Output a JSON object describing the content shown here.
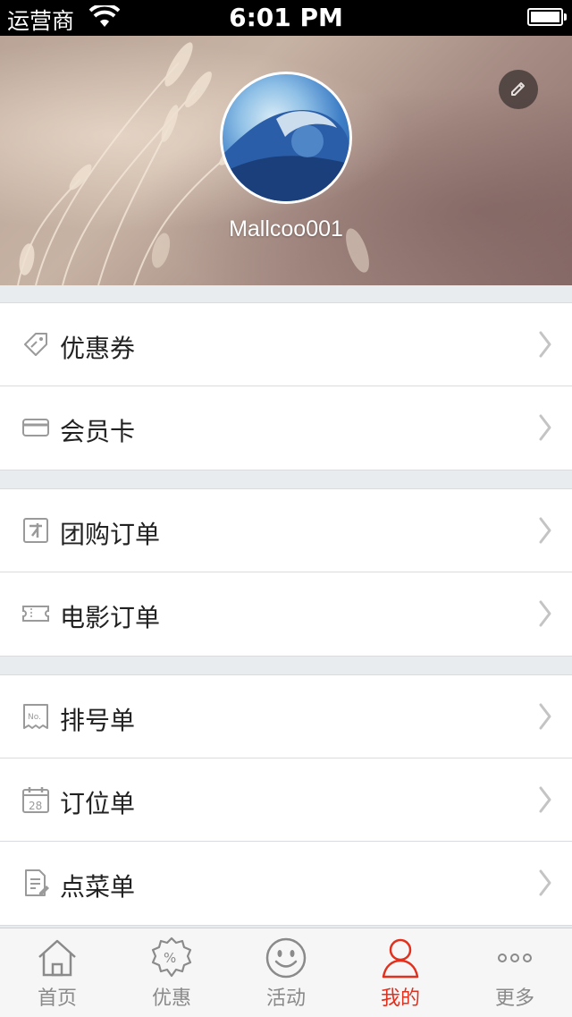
{
  "status_bar": {
    "carrier": "运营商",
    "time": "6:01 PM"
  },
  "profile": {
    "username": "Mallcoo001"
  },
  "menu_groups": [
    {
      "items": [
        {
          "label": "优惠券",
          "icon": "coupon-icon"
        },
        {
          "label": "会员卡",
          "icon": "card-icon"
        }
      ]
    },
    {
      "items": [
        {
          "label": "团购订单",
          "icon": "group-buy-icon"
        },
        {
          "label": "电影订单",
          "icon": "ticket-icon"
        }
      ]
    },
    {
      "items": [
        {
          "label": "排号单",
          "icon": "queue-number-icon"
        },
        {
          "label": "订位单",
          "icon": "calendar-icon"
        },
        {
          "label": "点菜单",
          "icon": "order-list-icon"
        }
      ]
    }
  ],
  "tabs": [
    {
      "label": "首页",
      "icon": "home-icon"
    },
    {
      "label": "优惠",
      "icon": "discount-icon"
    },
    {
      "label": "活动",
      "icon": "smile-icon"
    },
    {
      "label": "我的",
      "icon": "person-icon",
      "active": true
    },
    {
      "label": "更多",
      "icon": "more-icon"
    }
  ],
  "colors": {
    "accent": "#e0301e",
    "tab_inactive": "#8a8a8a",
    "separator": "#e9ecef"
  }
}
